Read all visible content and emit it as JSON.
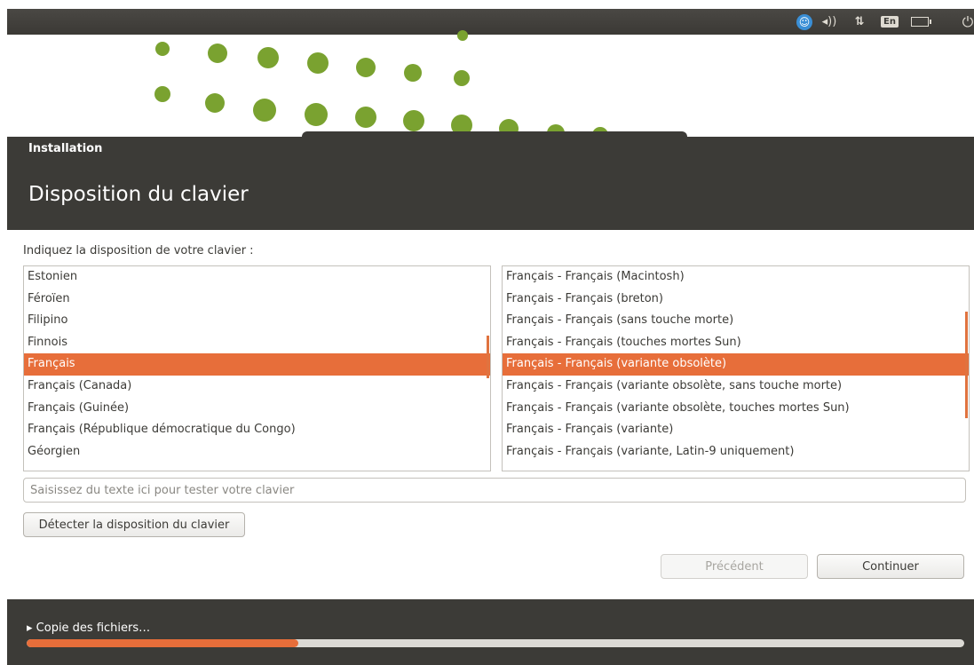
{
  "panel": {
    "accessibility_glyph": "☺",
    "sound_glyph": "◂))",
    "network_glyph": "⇅",
    "language": "En",
    "power_glyph": "⏻"
  },
  "window": {
    "title": "Installation",
    "step_title": "Disposition du clavier"
  },
  "layout_prompt": "Indiquez la disposition de votre clavier :",
  "layouts": {
    "items": [
      "Estonien",
      "Féroïen",
      "Filipino",
      "Finnois",
      "Français",
      "Français (Canada)",
      "Français (Guinée)",
      "Français (République démocratique du Congo)",
      "Géorgien"
    ],
    "selected_index": 4
  },
  "variants": {
    "items": [
      "Français - Français (Macintosh)",
      "Français - Français (breton)",
      "Français - Français (sans touche morte)",
      "Français - Français (touches mortes Sun)",
      "Français - Français (variante obsolète)",
      "Français - Français (variante obsolète, sans touche morte)",
      "Français - Français (variante obsolète, touches mortes Sun)",
      "Français - Français (variante)",
      "Français - Français (variante, Latin-9 uniquement)"
    ],
    "selected_index": 4
  },
  "test_input": {
    "placeholder": "Saisissez du texte ici pour tester votre clavier",
    "value": ""
  },
  "buttons": {
    "detect": "Détecter la disposition du clavier",
    "back": "Précédent",
    "continue": "Continuer"
  },
  "progress": {
    "label": "▸ Copie des fichiers…",
    "fraction": 0.29
  },
  "colors": {
    "accent": "#e76e3a",
    "header_bg": "#3c3b37",
    "dots": "#7aa230"
  }
}
